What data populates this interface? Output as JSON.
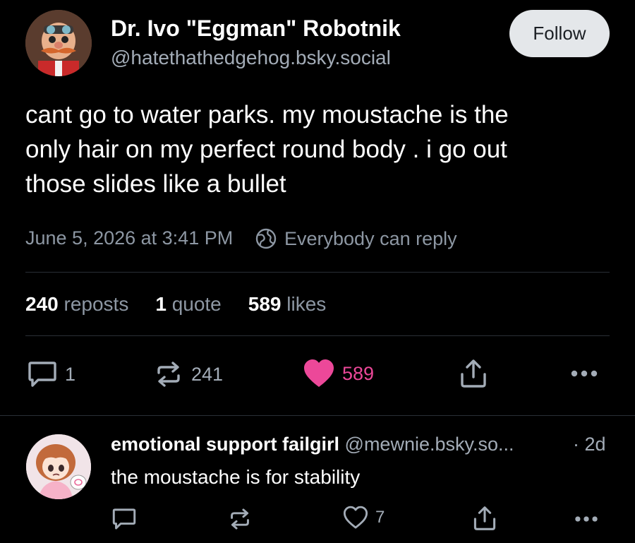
{
  "post": {
    "author_name": "Dr. Ivo \"Eggman\" Robotnik",
    "author_handle": "@hatethathedgehog.bsky.social",
    "follow_label": "Follow",
    "text": "cant go to water parks. my moustache is the\nonly hair on my perfect round body . i go out\nthose slides like a bullet",
    "date": "June 5, 2026 at 3:41 PM",
    "reply_setting": "Everybody can reply",
    "stats": {
      "reposts_count": "240",
      "reposts_label": "reposts",
      "quotes_count": "1",
      "quotes_label": "quote",
      "likes_count": "589",
      "likes_label": "likes"
    },
    "actions": {
      "reply_count": "1",
      "repost_count": "241",
      "like_count": "589"
    }
  },
  "reply": {
    "author_name": "emotional support failgirl",
    "author_handle": "@mewnie.bsky.so...",
    "age": "· 2d",
    "text": "the moustache is for stability",
    "like_count": "7"
  },
  "colors": {
    "background": "#000000",
    "text_primary": "#ffffff",
    "text_secondary": "#8d97a3",
    "like_accent": "#ec4899",
    "follow_button_bg": "#e4e7ea",
    "divider": "#2a2f36"
  },
  "icons": {
    "reply": "speech-bubble-icon",
    "repost": "repost-arrows-icon",
    "like_active": "heart-filled-icon",
    "like": "heart-outline-icon",
    "share": "share-upload-icon",
    "more": "more-dots-icon",
    "reply_setting": "globe-icon"
  }
}
